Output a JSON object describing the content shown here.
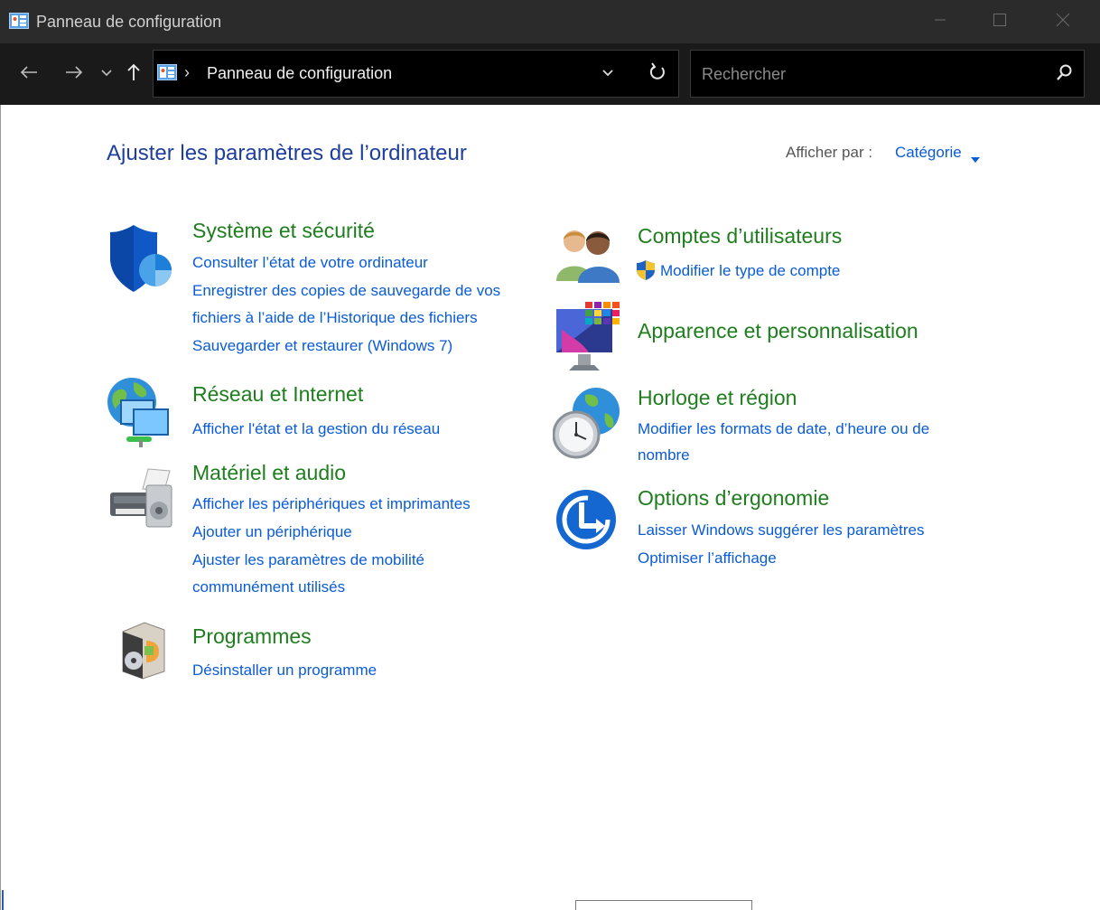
{
  "window": {
    "title": "Panneau de configuration"
  },
  "address_bar": {
    "crumb": "Panneau de configuration",
    "search_placeholder": "Rechercher"
  },
  "header": {
    "title": "Ajuster les paramètres de l’ordinateur",
    "view_by_label": "Afficher par :",
    "view_by_value": "Catégorie"
  },
  "categories": {
    "system": {
      "title": "Système et sécurité",
      "links": [
        "Consulter l’état de votre ordinateur",
        "Enregistrer des copies de sauvegarde de vos",
        "fichiers à l’aide de l’Historique des fichiers",
        "Sauvegarder et restaurer (Windows 7)"
      ]
    },
    "network": {
      "title": "Réseau et Internet",
      "links": [
        "Afficher l'état et la gestion du réseau"
      ]
    },
    "hardware": {
      "title": "Matériel et audio",
      "links": [
        "Afficher les périphériques et imprimantes",
        "Ajouter un périphérique",
        "Ajuster les paramètres de mobilité",
        "communément utilisés"
      ]
    },
    "programs": {
      "title": "Programmes",
      "links": [
        "Désinstaller un programme"
      ]
    },
    "accounts": {
      "title": "Comptes d’utilisateurs",
      "links": [
        "Modifier le type de compte"
      ]
    },
    "appearance": {
      "title": "Apparence et personnalisation",
      "links": []
    },
    "clock": {
      "title": "Horloge et région",
      "links": [
        "Modifier les formats de date, d’heure ou de",
        "nombre"
      ]
    },
    "ease": {
      "title": "Options d’ergonomie",
      "links": [
        "Laisser Windows suggérer les paramètres",
        "Optimiser l’affichage"
      ]
    }
  },
  "colors": {
    "category_title": "#1e7e1e",
    "link": "#0a5bd6",
    "page_title": "#1d3f9b",
    "titlebar_bg": "#2b2b2b",
    "navbar_bg": "#1a1a1a"
  }
}
